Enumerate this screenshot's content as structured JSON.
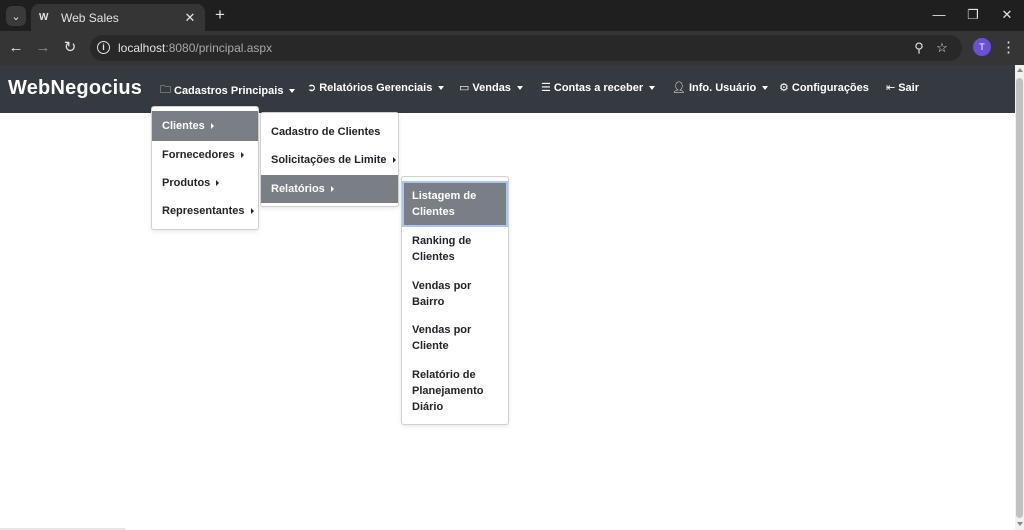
{
  "browser": {
    "tab_title": "Web Sales",
    "tab_favicon": "W",
    "url_host": "localhost",
    "url_path": ":8080/principal.aspx",
    "profile_initial": "T",
    "icons": [
      "tab-search-icon",
      "close-icon",
      "plus-icon",
      "minimize-icon",
      "restore-icon",
      "close-window-icon",
      "back-icon",
      "forward-icon",
      "reload-icon",
      "info-icon",
      "zoom-icon",
      "star-icon",
      "menu-icon"
    ]
  },
  "navbar": {
    "brand": "WebNegocius",
    "items": [
      {
        "label": "Cadastros Principais",
        "icon": "folder-icon",
        "dropdown": true
      },
      {
        "label": "Relatórios Gerenciais",
        "icon": "arrow-circle-icon",
        "dropdown": true
      },
      {
        "label": "Vendas",
        "icon": "briefcase-icon",
        "dropdown": true
      },
      {
        "label": "Contas a receber",
        "icon": "list-icon",
        "dropdown": true
      },
      {
        "label": "Info. Usuário",
        "icon": "user-icon",
        "dropdown": true
      },
      {
        "label": "Configurações",
        "icon": "gear-icon",
        "dropdown": false
      },
      {
        "label": "Sair",
        "icon": "sign-out-icon",
        "dropdown": false
      }
    ]
  },
  "menu_level1": {
    "items": [
      {
        "label": "Clientes",
        "active": true
      },
      {
        "label": "Fornecedores",
        "active": false
      },
      {
        "label": "Produtos",
        "active": false
      },
      {
        "label": "Representantes",
        "active": false
      }
    ]
  },
  "menu_level2": {
    "items": [
      {
        "label": "Cadastro de Clientes",
        "submenu": false,
        "active": false
      },
      {
        "label": "Solicitações de Limite",
        "submenu": true,
        "active": false
      },
      {
        "label": "Relatórios",
        "submenu": true,
        "active": true
      }
    ]
  },
  "menu_level3": {
    "items": [
      {
        "label": "Listagem de Clientes",
        "active": true
      },
      {
        "label": "Ranking de Clientes",
        "active": false
      },
      {
        "label": "Vendas por Bairro",
        "active": false
      },
      {
        "label": "Vendas por Cliente",
        "active": false
      },
      {
        "label": "Relatório de Planejamento Diário",
        "active": false
      }
    ]
  },
  "colors": {
    "navbar_bg": "#343a40",
    "active_item_bg": "#7a7f85",
    "focus_outline": "#a9c6f5"
  }
}
